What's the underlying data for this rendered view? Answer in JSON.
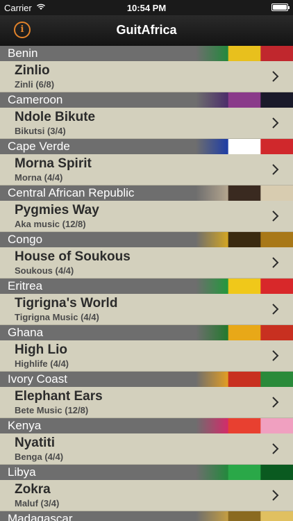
{
  "status": {
    "carrier": "Carrier",
    "time": "10:54 PM"
  },
  "nav": {
    "title": "GuitAfrica",
    "info_label": "i"
  },
  "sections": [
    {
      "country": "Benin",
      "song": "Zinlio",
      "style": "Zinli (6/8)",
      "flag_colors": [
        "#1f8a3a",
        "#e8c01d",
        "#c0272d"
      ]
    },
    {
      "country": "Cameroon",
      "song": "Ndole Bikute",
      "style": "Bikutsi  (3/4)",
      "flag_colors": [
        "#4a2a6a",
        "#8a3a8a",
        "#1a1a2a"
      ]
    },
    {
      "country": "Cape Verde",
      "song": "Morna Spirit",
      "style": "Morna (4/4)",
      "flag_colors": [
        "#1a3aa8",
        "#ffffff",
        "#d0282c"
      ]
    },
    {
      "country": "Central African Republic",
      "song": "Pygmies Way",
      "style": "Aka music (12/8)",
      "flag_colors": [
        "#b8a890",
        "#3a2a20",
        "#d8ccb0"
      ]
    },
    {
      "country": "Congo",
      "song": "House of Soukous",
      "style": "Soukous (4/4)",
      "flag_colors": [
        "#d8a820",
        "#3a2a10",
        "#a87818"
      ]
    },
    {
      "country": "Eritrea",
      "song": "Tigrigna's World",
      "style": "Tigrigna Music (4/4)",
      "flag_colors": [
        "#1f9a3a",
        "#f0c81a",
        "#d8282a"
      ]
    },
    {
      "country": "Ghana",
      "song": "High Lio",
      "style": "Highlife (4/4)",
      "flag_colors": [
        "#1f7a2a",
        "#e8a818",
        "#c83020"
      ]
    },
    {
      "country": "Ivory Coast",
      "song": "Elephant Ears",
      "style": "Bete Music (12/8)",
      "flag_colors": [
        "#e8a020",
        "#c83020",
        "#2a8a3a"
      ]
    },
    {
      "country": "Kenya",
      "song": "Nyatiti",
      "style": "Benga (4/4)",
      "flag_colors": [
        "#d8286a",
        "#e84030",
        "#f0a0c0"
      ]
    },
    {
      "country": "Libya",
      "song": "Zokra",
      "style": "Maluf (3/4)",
      "flag_colors": [
        "#1f8a3a",
        "#2aa848",
        "#0a5a20"
      ]
    },
    {
      "country": "Madagascar",
      "song": "",
      "style": "",
      "flag_colors": [
        "#c8a040",
        "#8a6a20",
        "#e0c060"
      ]
    }
  ]
}
